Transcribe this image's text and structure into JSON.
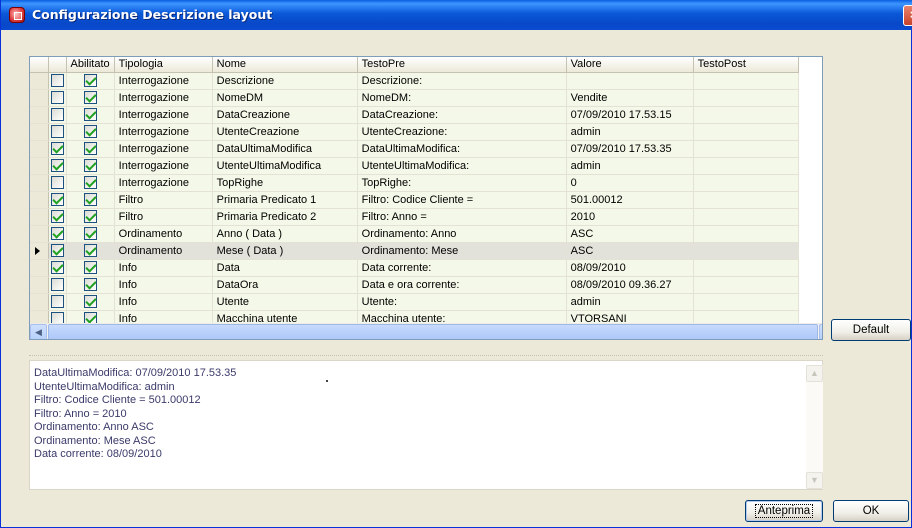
{
  "window": {
    "title": "Configurazione Descrizione layout",
    "close_symbol": "×"
  },
  "grid": {
    "columns": [
      "Abilitato",
      "Tipologia",
      "Nome",
      "TestoPre",
      "Valore",
      "TestoPost"
    ],
    "selected_row_index": 11,
    "rows": [
      {
        "sel": false,
        "abilitato": true,
        "tipologia": "Interrogazione",
        "nome": "Descrizione",
        "testopre": "Descrizione:",
        "valore": "",
        "testopost": ""
      },
      {
        "sel": false,
        "abilitato": true,
        "tipologia": "Interrogazione",
        "nome": "NomeDM",
        "testopre": "NomeDM:",
        "valore": "Vendite",
        "testopost": ""
      },
      {
        "sel": false,
        "abilitato": true,
        "tipologia": "Interrogazione",
        "nome": "DataCreazione",
        "testopre": "DataCreazione:",
        "valore": "07/09/2010 17.53.15",
        "testopost": ""
      },
      {
        "sel": false,
        "abilitato": true,
        "tipologia": "Interrogazione",
        "nome": "UtenteCreazione",
        "testopre": "UtenteCreazione:",
        "valore": "admin",
        "testopost": ""
      },
      {
        "sel": true,
        "abilitato": true,
        "tipologia": "Interrogazione",
        "nome": "DataUltimaModifica",
        "testopre": "DataUltimaModifica:",
        "valore": "07/09/2010 17.53.35",
        "testopost": ""
      },
      {
        "sel": true,
        "abilitato": true,
        "tipologia": "Interrogazione",
        "nome": "UtenteUltimaModifica",
        "testopre": "UtenteUltimaModifica:",
        "valore": "admin",
        "testopost": ""
      },
      {
        "sel": false,
        "abilitato": true,
        "tipologia": "Interrogazione",
        "nome": "TopRighe",
        "testopre": "TopRighe:",
        "valore": "0",
        "testopost": ""
      },
      {
        "sel": true,
        "abilitato": true,
        "tipologia": "Filtro",
        "nome": "Primaria Predicato 1",
        "testopre": "Filtro: Codice Cliente =",
        "valore": "501.00012",
        "testopost": ""
      },
      {
        "sel": true,
        "abilitato": true,
        "tipologia": "Filtro",
        "nome": "Primaria Predicato 2",
        "testopre": "Filtro: Anno =",
        "valore": "2010",
        "testopost": ""
      },
      {
        "sel": true,
        "abilitato": true,
        "tipologia": "Ordinamento",
        "nome": "Anno ( Data )",
        "testopre": "Ordinamento: Anno",
        "valore": "ASC",
        "testopost": ""
      },
      {
        "sel": true,
        "abilitato": true,
        "tipologia": "Ordinamento",
        "nome": "Mese ( Data )",
        "testopre": "Ordinamento: Mese",
        "valore": "ASC",
        "testopost": ""
      },
      {
        "sel": true,
        "abilitato": true,
        "tipologia": "Info",
        "nome": "Data",
        "testopre": "Data corrente:",
        "valore": "08/09/2010",
        "testopost": ""
      },
      {
        "sel": false,
        "abilitato": true,
        "tipologia": "Info",
        "nome": "DataOra",
        "testopre": "Data e ora corrente:",
        "valore": "08/09/2010 09.36.27",
        "testopost": ""
      },
      {
        "sel": false,
        "abilitato": true,
        "tipologia": "Info",
        "nome": "Utente",
        "testopre": "Utente:",
        "valore": "admin",
        "testopost": ""
      },
      {
        "sel": false,
        "abilitato": true,
        "tipologia": "Info",
        "nome": "Macchina utente",
        "testopre": "Macchina utente:",
        "valore": "VTORSANI",
        "testopost": ""
      }
    ]
  },
  "buttons": {
    "default": "Default",
    "anteprima": "Anteprima",
    "ok": "OK"
  },
  "preview": {
    "lines": [
      "DataUltimaModifica: 07/09/2010 17.53.35",
      "UtenteUltimaModifica: admin",
      "Filtro: Codice Cliente = 501.00012",
      "Filtro: Anno = 2010",
      "Ordinamento: Anno  ASC",
      "Ordinamento: Mese  ASC",
      "Data corrente: 08/09/2010"
    ]
  },
  "icons": {
    "scroll_up": "▲",
    "scroll_down": "▼",
    "scroll_left": "◀",
    "scroll_right": "▶"
  },
  "colors": {
    "titlebar": "#0a58d8",
    "grid_row_bg": "#f4f8e8",
    "selected_row_bg": "#e3e2da",
    "checkbox_check": "#21a121"
  }
}
